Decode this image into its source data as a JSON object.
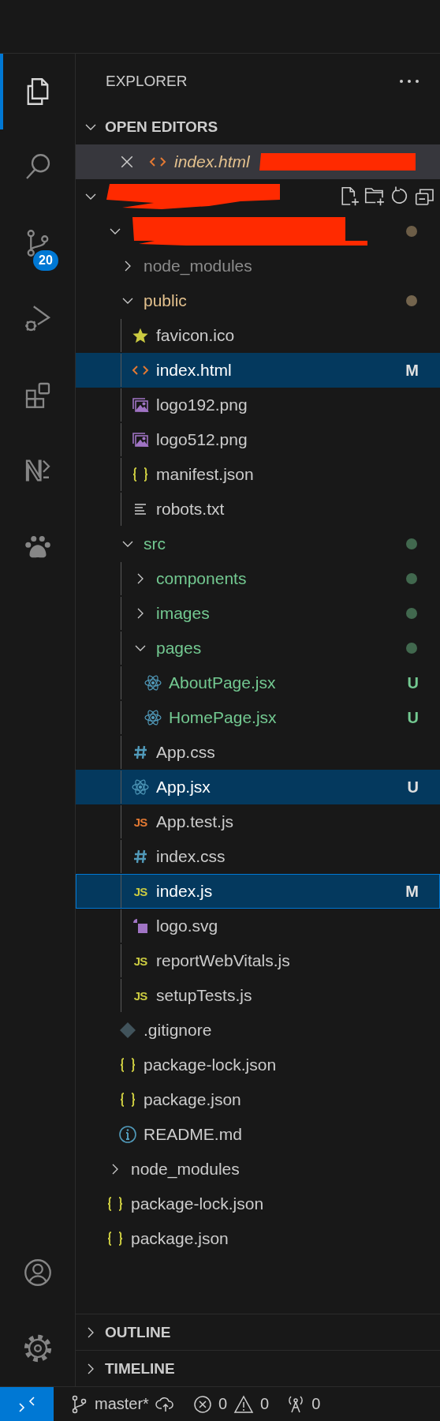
{
  "activity_bar": [
    {
      "kind": "explorer",
      "selected": true
    },
    {
      "kind": "search",
      "selected": false
    },
    {
      "kind": "source-control",
      "selected": false,
      "badge": "20"
    },
    {
      "kind": "run-debug",
      "selected": false
    },
    {
      "kind": "extensions",
      "selected": false
    },
    {
      "kind": "notebook",
      "selected": false
    },
    {
      "kind": "paw",
      "selected": false
    }
  ],
  "activity_bar_bottom": [
    {
      "kind": "account"
    },
    {
      "kind": "settings"
    }
  ],
  "explorer": {
    "title": "EXPLORER"
  },
  "open_editors": {
    "title": "OPEN EDITORS",
    "expanded": true,
    "items": [
      {
        "name": "index.html",
        "kind": "html",
        "color": "#e2c08d",
        "preview": true,
        "selected": true,
        "redacted": true
      }
    ]
  },
  "workspace": {
    "expanded": true,
    "redacted": true,
    "children": [
      {
        "kind": "folder",
        "redacted": true,
        "expanded": true,
        "color": "#6c5d47",
        "dot": true,
        "selected": false,
        "focused": false,
        "children": [
          {
            "kind": "folder",
            "name": "node_modules",
            "expanded": false,
            "color": "#8c8c8c",
            "dot": false,
            "selected": false,
            "focused": false
          },
          {
            "kind": "folder",
            "name": "public",
            "expanded": true,
            "color": "#e2c08d",
            "dot": true,
            "selected": false,
            "focused": false,
            "children": [
              {
                "kind": "star",
                "name": "favicon.ico",
                "selected": false,
                "focused": false
              },
              {
                "kind": "html",
                "name": "index.html",
                "badge": "M",
                "selected": true,
                "focused": false
              },
              {
                "kind": "image",
                "name": "logo192.png",
                "selected": false,
                "focused": false
              },
              {
                "kind": "image",
                "name": "logo512.png",
                "selected": false,
                "focused": false
              },
              {
                "kind": "json",
                "name": "manifest.json",
                "selected": false,
                "focused": false
              },
              {
                "kind": "text",
                "name": "robots.txt",
                "selected": false,
                "focused": false
              }
            ]
          },
          {
            "kind": "folder",
            "name": "src",
            "expanded": true,
            "color": "#73c991",
            "dot": true,
            "selected": false,
            "focused": false,
            "children": [
              {
                "kind": "folder",
                "name": "components",
                "expanded": false,
                "color": "#73c991",
                "dot": true,
                "selected": false,
                "focused": false
              },
              {
                "kind": "folder",
                "name": "images",
                "expanded": false,
                "color": "#73c991",
                "dot": true,
                "selected": false,
                "focused": false
              },
              {
                "kind": "folder",
                "name": "pages",
                "expanded": true,
                "color": "#73c991",
                "dot": true,
                "selected": false,
                "focused": false,
                "children": [
                  {
                    "kind": "react",
                    "name": "AboutPage.jsx",
                    "color": "#73c991",
                    "badge": "U",
                    "selected": false,
                    "focused": false
                  },
                  {
                    "kind": "react",
                    "name": "HomePage.jsx",
                    "color": "#73c991",
                    "badge": "U",
                    "selected": false,
                    "focused": false
                  }
                ]
              },
              {
                "kind": "css",
                "name": "App.css",
                "selected": false,
                "focused": false
              },
              {
                "kind": "react",
                "name": "App.jsx",
                "badge": "U",
                "selected": true,
                "focused": false
              },
              {
                "kind": "js-test",
                "name": "App.test.js",
                "icon_label": "JS",
                "selected": false,
                "focused": false
              },
              {
                "kind": "css",
                "name": "index.css",
                "selected": false,
                "focused": false
              },
              {
                "kind": "js",
                "name": "index.js",
                "icon_label": "JS",
                "badge": "M",
                "selected": true,
                "focused": true
              },
              {
                "kind": "svg",
                "name": "logo.svg",
                "selected": false,
                "focused": false
              },
              {
                "kind": "js",
                "name": "reportWebVitals.js",
                "icon_label": "JS",
                "selected": false,
                "focused": false
              },
              {
                "kind": "js",
                "name": "setupTests.js",
                "icon_label": "JS",
                "selected": false,
                "focused": false
              }
            ]
          },
          {
            "kind": "git",
            "name": ".gitignore",
            "selected": false,
            "focused": false
          },
          {
            "kind": "json",
            "name": "package-lock.json",
            "selected": false,
            "focused": false
          },
          {
            "kind": "json",
            "name": "package.json",
            "selected": false,
            "focused": false
          },
          {
            "kind": "info",
            "name": "README.md",
            "selected": false,
            "focused": false
          }
        ]
      },
      {
        "kind": "folder",
        "name": "node_modules",
        "expanded": false,
        "dot": false,
        "selected": false,
        "focused": false
      },
      {
        "kind": "json",
        "name": "package-lock.json",
        "selected": false,
        "focused": false
      },
      {
        "kind": "json",
        "name": "package.json",
        "selected": false,
        "focused": false
      }
    ]
  },
  "sections": [
    {
      "title": "OUTLINE",
      "expanded": false
    },
    {
      "title": "TIMELINE",
      "expanded": false
    }
  ],
  "status_bar": {
    "branch": "master*",
    "errors": "0",
    "warnings": "0",
    "ports": "0"
  }
}
